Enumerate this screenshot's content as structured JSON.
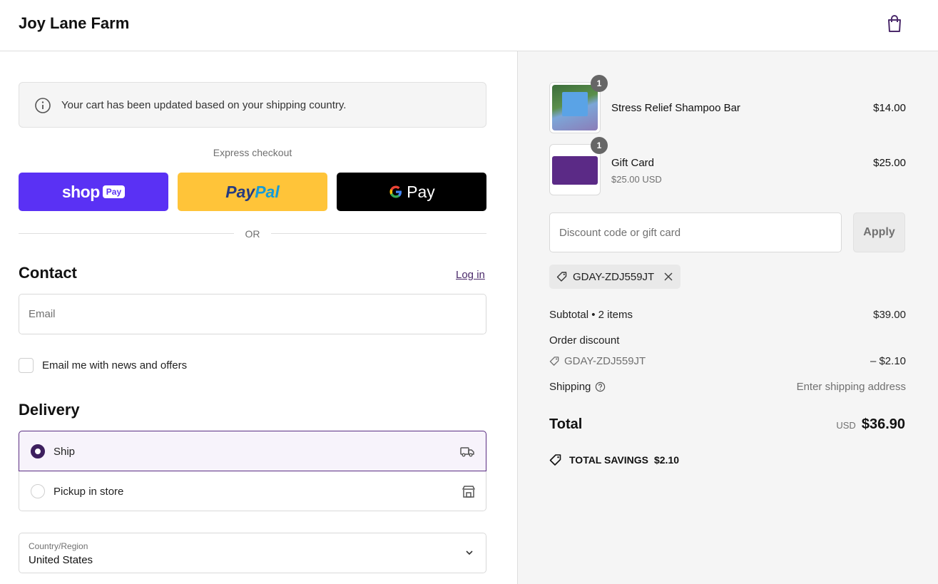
{
  "header": {
    "brand": "Joy Lane Farm",
    "cart_icon": "shopping-bag-icon"
  },
  "banner": {
    "icon": "info-icon",
    "text": "Your cart has been updated based on your shipping country."
  },
  "express": {
    "label": "Express checkout",
    "shop_pay": {
      "word": "shop",
      "badge": "Pay"
    },
    "paypal": {
      "part1": "Pay",
      "part2": "Pal"
    },
    "gpay": {
      "g": "G",
      "pay": "Pay"
    },
    "or": "OR"
  },
  "contact": {
    "title": "Contact",
    "login_link": "Log in",
    "email_placeholder": "Email",
    "newsletter_label": "Email me with news and offers"
  },
  "delivery": {
    "title": "Delivery",
    "options": [
      {
        "label": "Ship",
        "icon": "truck-icon",
        "selected": true
      },
      {
        "label": "Pickup in store",
        "icon": "store-icon",
        "selected": false
      }
    ],
    "country": {
      "label": "Country/Region",
      "value": "United States"
    }
  },
  "summary": {
    "items": [
      {
        "name": "Stress Relief Shampoo Bar",
        "sub": "",
        "price": "$14.00",
        "qty": "1"
      },
      {
        "name": "Gift Card",
        "sub": "$25.00 USD",
        "price": "$25.00",
        "qty": "1"
      }
    ],
    "discount_placeholder": "Discount code or gift card",
    "apply_label": "Apply",
    "applied_code": "GDAY-ZDJ559JT",
    "subtotal_label": "Subtotal • 2 items",
    "subtotal_value": "$39.00",
    "order_discount_label": "Order discount",
    "discount_code": "GDAY-ZDJ559JT",
    "discount_value": "– $2.10",
    "shipping_label": "Shipping",
    "shipping_value": "Enter shipping address",
    "total_label": "Total",
    "total_currency": "USD",
    "total_value": "$36.90",
    "savings_label": "TOTAL SAVINGS",
    "savings_value": "$2.10"
  },
  "colors": {
    "accent": "#3d1f5e",
    "shop_pay": "#5a31f4",
    "paypal": "#ffc439",
    "link": "#4b2a6b"
  }
}
